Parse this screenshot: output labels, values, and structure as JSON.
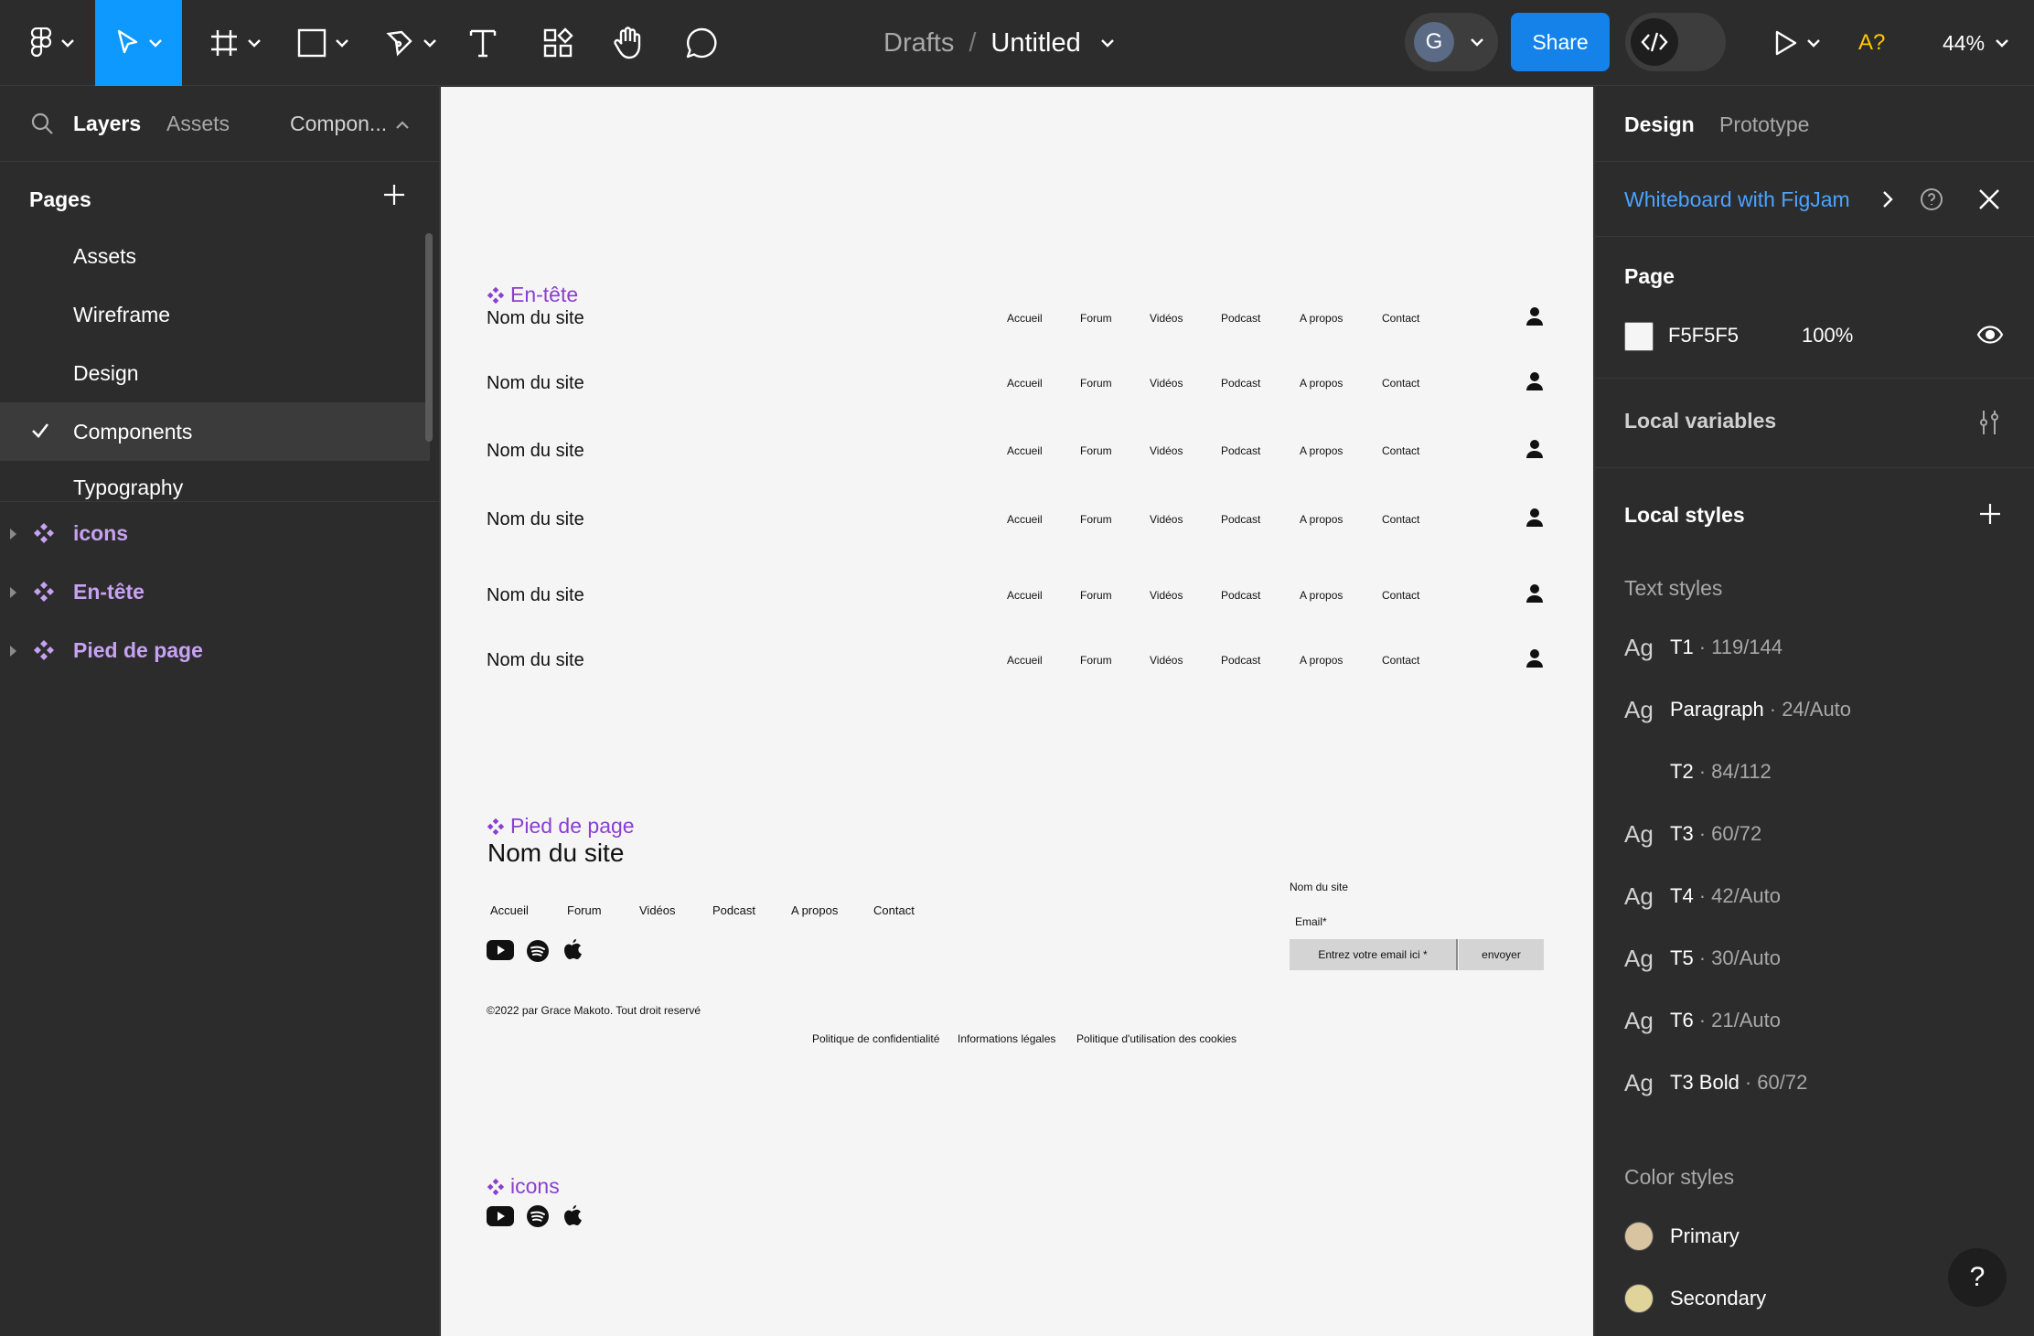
{
  "toolbar": {
    "breadcrumb_drafts": "Drafts",
    "breadcrumb_sep": "/",
    "file_name": "Untitled",
    "avatar_initial": "G",
    "share_label": "Share",
    "a11y_label": "A?",
    "zoom_label": "44%"
  },
  "left_panel": {
    "tabs": {
      "layers": "Layers",
      "assets": "Assets",
      "components": "Compon..."
    },
    "pages_heading": "Pages",
    "pages": [
      "Assets",
      "Wireframe",
      "Design",
      "Components",
      "Typography"
    ],
    "selected_page": "Components",
    "layers": [
      "icons",
      "En-tête",
      "Pied de page"
    ]
  },
  "canvas": {
    "header_frame_label": "En-tête",
    "header_site_name": "Nom du site",
    "header_nav": [
      "Accueil",
      "Forum",
      "Vidéos",
      "Podcast",
      "A propos",
      "Contact"
    ],
    "footer_frame_label": "Pied de page",
    "footer_site_name": "Nom du site",
    "footer_nav": [
      "Accueil",
      "Forum",
      "Vidéos",
      "Podcast",
      "A propos",
      "Contact"
    ],
    "footer_form_title": "Nom du site",
    "footer_email_label": "Email*",
    "footer_email_placeholder": "Entrez votre email ici *",
    "footer_send_label": "envoyer",
    "footer_copyright": "©2022 par Grace Makoto. Tout droit reservé",
    "footer_legal": [
      "Politique de confidentialité",
      "Informations légales",
      "Politique d'utilisation des cookies"
    ],
    "icons_frame_label": "icons",
    "icon_names": [
      "youtube-icon",
      "spotify-icon",
      "apple-icon"
    ]
  },
  "right_panel": {
    "tabs": {
      "design": "Design",
      "prototype": "Prototype"
    },
    "banner_link": "Whiteboard with FigJam",
    "page_heading": "Page",
    "page_color": "F5F5F5",
    "page_opacity": "100%",
    "local_variables": "Local variables",
    "local_styles": "Local styles",
    "text_styles_heading": "Text styles",
    "text_styles": [
      {
        "ag": "Ag",
        "name": "T1",
        "meta": "· 119/144"
      },
      {
        "ag": "Ag",
        "name": "Paragraph",
        "meta": "· 24/Auto"
      },
      {
        "ag": "",
        "name": "T2",
        "meta": "· 84/112"
      },
      {
        "ag": "Ag",
        "name": "T3",
        "meta": "· 60/72"
      },
      {
        "ag": "Ag",
        "name": "T4",
        "meta": "· 42/Auto"
      },
      {
        "ag": "Ag",
        "name": "T5",
        "meta": "· 30/Auto"
      },
      {
        "ag": "Ag",
        "name": "T6",
        "meta": "· 21/Auto"
      },
      {
        "ag": "Ag",
        "name": "T3 Bold",
        "meta": "· 60/72"
      }
    ],
    "color_styles_heading": "Color styles",
    "color_styles": [
      {
        "name": "Primary",
        "color": "#d8c4a0"
      },
      {
        "name": "Secondary",
        "color": "#e0d49a"
      }
    ],
    "help_label": "?"
  },
  "colors": {
    "accent": "#0d99ff",
    "share": "#1482e8",
    "component_purple": "#8a3fd1",
    "layer_purple": "#c7a2f2"
  }
}
